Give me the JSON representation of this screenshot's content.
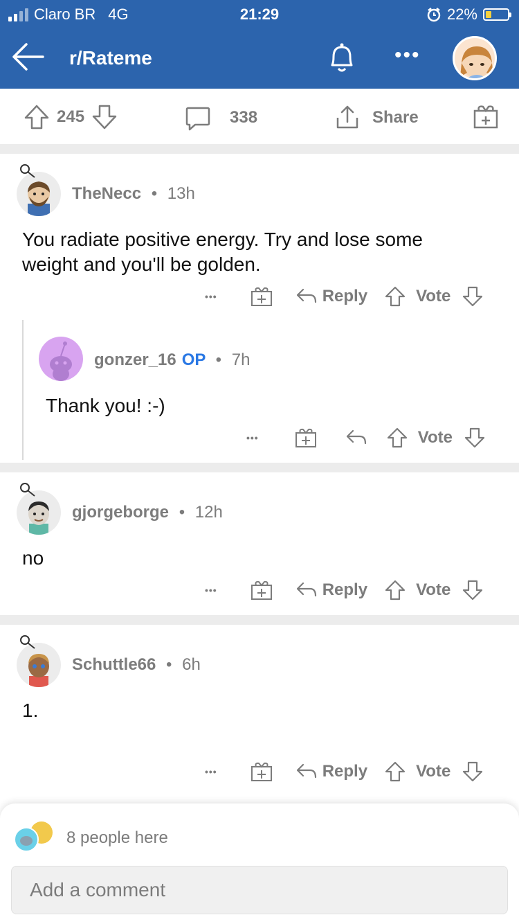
{
  "status_bar": {
    "carrier": "Claro BR",
    "network": "4G",
    "time": "21:29",
    "battery": "22%"
  },
  "header": {
    "title": "r/Rateme"
  },
  "post_actions": {
    "upvotes": "245",
    "comments": "338",
    "share_label": "Share"
  },
  "comments": [
    {
      "author": "TheNecc",
      "separator": "•",
      "time": "13h",
      "body": "You radiate positive energy. Try and lose some weight and you'll be golden.",
      "more": "•••",
      "reply_label": "Reply",
      "vote_label": "Vote"
    },
    {
      "author": "gonzer_16",
      "badge": "OP",
      "separator": "•",
      "time": "7h",
      "body": "Thank you! :-)",
      "more": "•••",
      "vote_label": "Vote"
    },
    {
      "author": "gjorgeborge",
      "separator": "•",
      "time": "12h",
      "body": "no",
      "more": "•••",
      "reply_label": "Reply",
      "vote_label": "Vote"
    },
    {
      "author": "Schuttle66",
      "separator": "•",
      "time": "6h",
      "body": "1.",
      "more": "•••",
      "reply_label": "Reply",
      "vote_label": "Vote"
    }
  ],
  "bottom": {
    "people_here": "8 people here",
    "placeholder": "Add a comment"
  },
  "colors": {
    "header_bg": "#2c64ad",
    "op_badge": "#2a78e4",
    "meta_gray": "#7c7c7c"
  }
}
